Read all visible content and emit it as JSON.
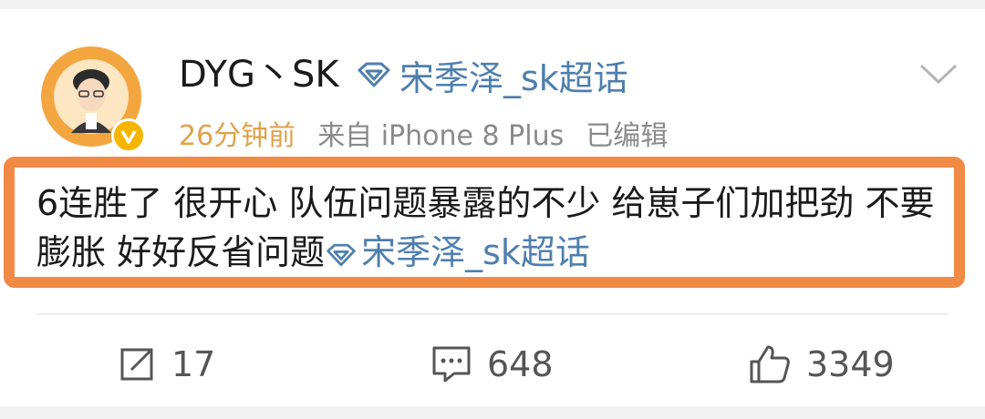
{
  "post": {
    "author": {
      "name": "DYG丶SK",
      "topic_tag": "宋季泽_sk超话"
    },
    "meta": {
      "time": "26分钟前",
      "source": "来自 iPhone 8 Plus",
      "edited": "已编辑"
    },
    "content": {
      "text": "6连胜了 很开心 队伍问题暴露的不少 给崽子们加把劲 不要膨胀 好好反省问题",
      "topic_link": "宋季泽_sk超话"
    },
    "actions": {
      "repost_count": "17",
      "comment_count": "648",
      "like_count": "3349"
    }
  },
  "colors": {
    "link": "#4f7fad",
    "time": "#e0a24a",
    "highlight_border": "#f08a44",
    "verified_badge": "#f7b500"
  },
  "icons": {
    "topic": "diamond-icon",
    "menu": "chevron-down-icon",
    "repost": "share-icon",
    "comment": "comment-icon",
    "like": "thumbs-up-icon"
  }
}
